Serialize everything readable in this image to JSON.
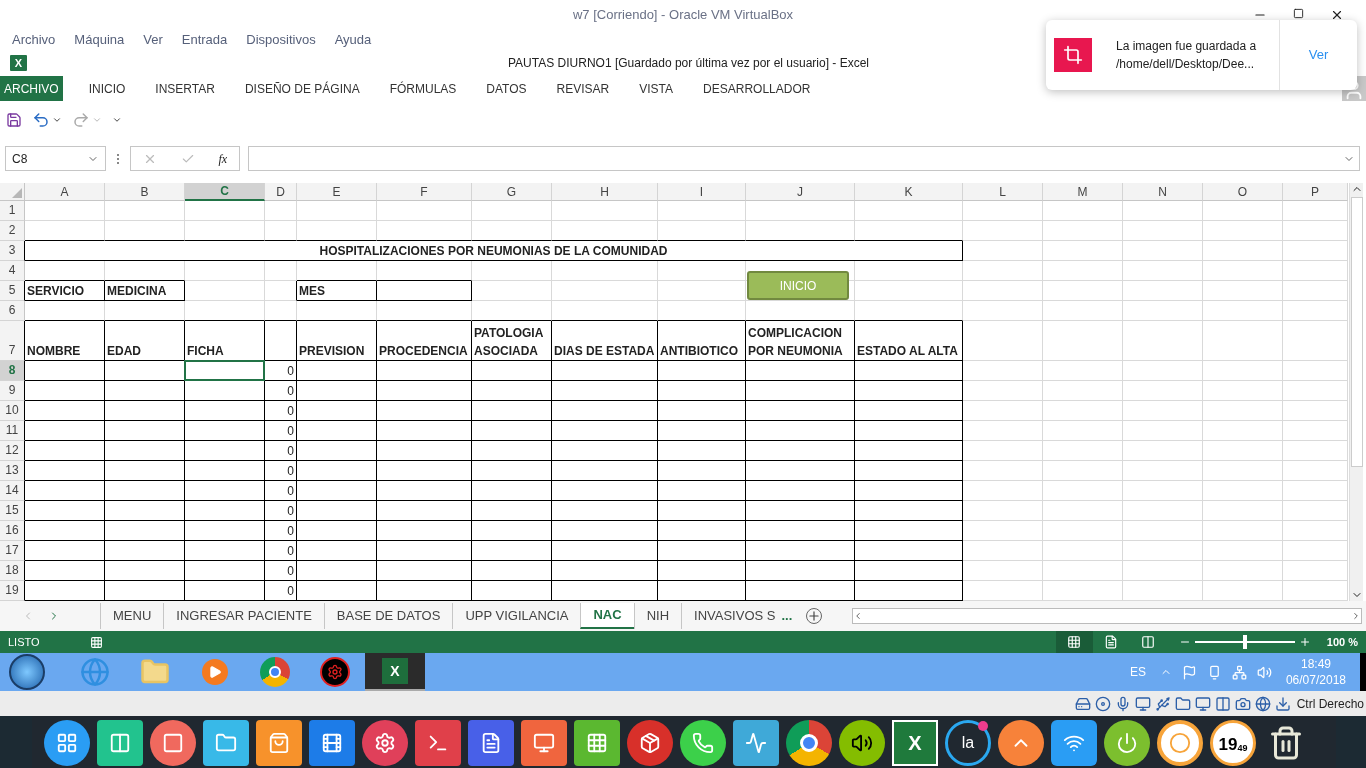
{
  "vm_window": {
    "title": "w7 [Corriendo] - Oracle VM VirtualBox",
    "menu": [
      "Archivo",
      "Máquina",
      "Ver",
      "Entrada",
      "Dispositivos",
      "Ayuda"
    ]
  },
  "excel": {
    "logo_letter": "X",
    "title": "PAUTAS DIURNO1 [Guardado por última vez por el usuario] - Excel",
    "ribbon_tabs": [
      {
        "label": "ARCHIVO",
        "selected": true
      },
      {
        "label": "INICIO",
        "selected": false
      },
      {
        "label": "INSERTAR",
        "selected": false
      },
      {
        "label": "DISEÑO DE PÁGINA",
        "selected": false
      },
      {
        "label": "FÓRMULAS",
        "selected": false
      },
      {
        "label": "DATOS",
        "selected": false
      },
      {
        "label": "REVISAR",
        "selected": false
      },
      {
        "label": "VISTA",
        "selected": false
      },
      {
        "label": "DESARROLLADOR",
        "selected": false
      }
    ],
    "name_box": "C8",
    "fx": "fx",
    "columns": [
      {
        "label": "A",
        "selected": false
      },
      {
        "label": "B",
        "selected": false
      },
      {
        "label": "C",
        "selected": true
      },
      {
        "label": "D",
        "selected": false
      },
      {
        "label": "E",
        "selected": false
      },
      {
        "label": "F",
        "selected": false
      },
      {
        "label": "G",
        "selected": false
      },
      {
        "label": "H",
        "selected": false
      },
      {
        "label": "I",
        "selected": false
      },
      {
        "label": "J",
        "selected": false
      },
      {
        "label": "K",
        "selected": false
      },
      {
        "label": "L",
        "selected": false
      },
      {
        "label": "M",
        "selected": false
      },
      {
        "label": "N",
        "selected": false
      },
      {
        "label": "O",
        "selected": false
      },
      {
        "label": "P",
        "selected": false
      }
    ],
    "rows": [
      {
        "number": "1",
        "kind": "blank",
        "selected": false
      },
      {
        "number": "2",
        "kind": "blank",
        "selected": false
      },
      {
        "number": "3",
        "kind": "title",
        "selected": false,
        "text": "HOSPITALIZACIONES POR NEUMONIAS DE LA COMUNIDAD"
      },
      {
        "number": "4",
        "kind": "blank",
        "selected": false
      },
      {
        "number": "5",
        "kind": "info",
        "selected": false,
        "servicio": "SERVICIO",
        "value": "MEDICINA",
        "mes": "MES"
      },
      {
        "number": "6",
        "kind": "blank",
        "selected": false
      },
      {
        "number": "7",
        "kind": "header",
        "selected": false,
        "headers": [
          "NOMBRE",
          "EDAD",
          "FICHA",
          "PREVISION",
          "PROCEDENCIA",
          "PATOLOGIA\nASOCIADA",
          "DIAS DE ESTADA",
          "ANTIBIOTICO",
          "COMPLICACION\nPOR NEUMONIA",
          "ESTADO AL ALTA"
        ]
      },
      {
        "number": "8",
        "kind": "data",
        "selected": true,
        "d": "0"
      },
      {
        "number": "9",
        "kind": "data",
        "selected": false,
        "d": "0"
      },
      {
        "number": "10",
        "kind": "data",
        "selected": false,
        "d": "0"
      },
      {
        "number": "11",
        "kind": "data",
        "selected": false,
        "d": "0"
      },
      {
        "number": "12",
        "kind": "data",
        "selected": false,
        "d": "0"
      },
      {
        "number": "13",
        "kind": "data",
        "selected": false,
        "d": "0"
      },
      {
        "number": "14",
        "kind": "data",
        "selected": false,
        "d": "0"
      },
      {
        "number": "15",
        "kind": "data",
        "selected": false,
        "d": "0"
      },
      {
        "number": "16",
        "kind": "data",
        "selected": false,
        "d": "0"
      },
      {
        "number": "17",
        "kind": "data",
        "selected": false,
        "d": "0"
      },
      {
        "number": "18",
        "kind": "data",
        "selected": false,
        "d": "0"
      },
      {
        "number": "19",
        "kind": "data",
        "selected": false,
        "d": "0"
      }
    ],
    "sheet_button": "INICIO",
    "sheet_tabs": [
      {
        "label": "MENU",
        "selected": false
      },
      {
        "label": "INGRESAR PACIENTE",
        "selected": false
      },
      {
        "label": "BASE DE DATOS",
        "selected": false
      },
      {
        "label": "UPP VIGILANCIA",
        "selected": false
      },
      {
        "label": "NAC",
        "selected": true
      },
      {
        "label": "NIH",
        "selected": false
      },
      {
        "label": "INVASIVOS S",
        "selected": false
      }
    ],
    "more_tabs": "...",
    "status": "LISTO",
    "views": [
      {
        "kind": "normal",
        "selected": true
      },
      {
        "kind": "layout",
        "selected": false
      },
      {
        "kind": "pagebreak",
        "selected": false
      }
    ],
    "zoom": {
      "level": 0.5,
      "reading": "100 %"
    }
  },
  "taskbar": {
    "items": [
      {
        "kind": "ie",
        "active": false
      },
      {
        "kind": "folder",
        "active": false
      },
      {
        "kind": "player",
        "active": false
      },
      {
        "kind": "chrome",
        "active": false
      },
      {
        "kind": "red",
        "active": false
      },
      {
        "kind": "excel",
        "active": true,
        "letter": "X"
      }
    ],
    "language": "ES",
    "time": "18:49",
    "date": "06/07/2018"
  },
  "vm_status": {
    "host_key": "Ctrl Derecho"
  },
  "dock": {
    "la_label": "la",
    "clock_hours": "19",
    "clock_minutes": "49",
    "excel_letter": "X"
  },
  "toast": {
    "line1": "La imagen fue guardada a",
    "line2": "/home/dell/Desktop/Dee...",
    "action": "Ver"
  }
}
